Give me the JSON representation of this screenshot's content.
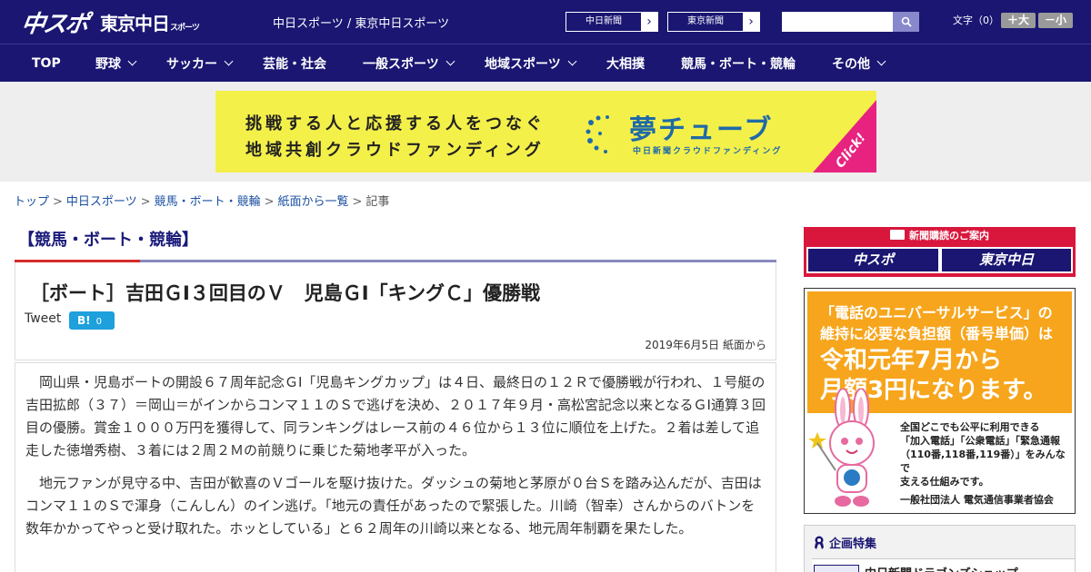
{
  "header": {
    "logo_main": "中スポ",
    "logo_sub": "東京中日",
    "logo_sub_small": "スポーツ",
    "site_names": "中日スポーツ / 東京中日スポーツ",
    "paper_buttons": [
      "中日新聞",
      "東京新聞"
    ],
    "font_size_label": "文字（0）",
    "font_larger": "＋大",
    "font_smaller": "－小"
  },
  "nav": {
    "items": [
      {
        "label": "TOP",
        "dropdown": false
      },
      {
        "label": "野球",
        "dropdown": true
      },
      {
        "label": "サッカー",
        "dropdown": true
      },
      {
        "label": "芸能・社会",
        "dropdown": false
      },
      {
        "label": "一般スポーツ",
        "dropdown": true
      },
      {
        "label": "地域スポーツ",
        "dropdown": true
      },
      {
        "label": "大相撲",
        "dropdown": false
      },
      {
        "label": "競馬・ボート・競輪",
        "dropdown": false
      },
      {
        "label": "その他",
        "dropdown": true
      }
    ]
  },
  "banner": {
    "line1": "挑戦する人と応援する人をつなぐ",
    "line2": "地域共創クラウドファンディング",
    "logo": "夢チューブ",
    "logo_sub": "中日新聞クラウドファンディング",
    "click": "Click!",
    "colors": {
      "bg": "#f4f04a",
      "accent": "#1f6aa8",
      "click_bg": "#e8237f"
    }
  },
  "breadcrumb": {
    "items": [
      "トップ",
      "中日スポーツ",
      "競馬・ボート・競輪",
      "紙面から一覧"
    ],
    "current": "記事",
    "sep": ">"
  },
  "category": "【競馬・ボート・競輪】",
  "article": {
    "title": "［ボート］吉田ＧⅠ３回目のＶ　児島ＧⅠ「キングＣ」優勝戦",
    "tweet": "Tweet",
    "hatena_label": "B!",
    "hatena_count": "0",
    "date": "2019年6月5日 紙面から",
    "paragraphs": [
      "岡山県・児島ボートの開設６７周年記念ＧⅠ「児島キングカップ」は４日、最終日の１２Ｒで優勝戦が行われ、１号艇の吉田拡郎（３７）＝岡山＝がインからコンマ１１のＳで逃げを決め、２０１７年９月・高松宮記念以来となるＧⅠ通算３回目の優勝。賞金１０００万円を獲得して、同ランキングはレース前の４６位から１３位に順位を上げた。２着は差して追走した徳増秀樹、３着には２周２Ｍの前競りに乗じた菊地孝平が入った。",
      "地元ファンが見守る中、吉田が歓喜のＶゴールを駆け抜けた。ダッシュの菊地と茅原が０台Ｓを踏み込んだが、吉田はコンマ１１のＳで渾身（こんしん）のイン逃げ。「地元の責任があったので緊張した。川崎（智幸）さんからのバトンを数年かかってやっと受け取れた。ホッとしている」と６２周年の川崎以来となる、地元周年制覇を果たした。"
    ]
  },
  "sidebar": {
    "subscribe_head": "新聞購読のご案内",
    "subscribe_buttons": [
      "中スポ",
      "東京中日"
    ],
    "ad": {
      "t1": "「電話のユニバーサルサービス」の",
      "t2": "維持に必要な負担額（番号単価）は",
      "t3": "令和元年7月から",
      "t4": "月額3円になります。",
      "lines": [
        "全国どこでも公平に利用できる",
        "「加入電話」「公衆電話」「緊急通報",
        "（110番,118番,119番）」をみんなで",
        "支える仕組みです。"
      ],
      "org": "一般社団法人 電気通信事業者協会"
    },
    "feature_title": "企画特集",
    "feature_item": "中日新聞ドラゴンズショップ"
  }
}
